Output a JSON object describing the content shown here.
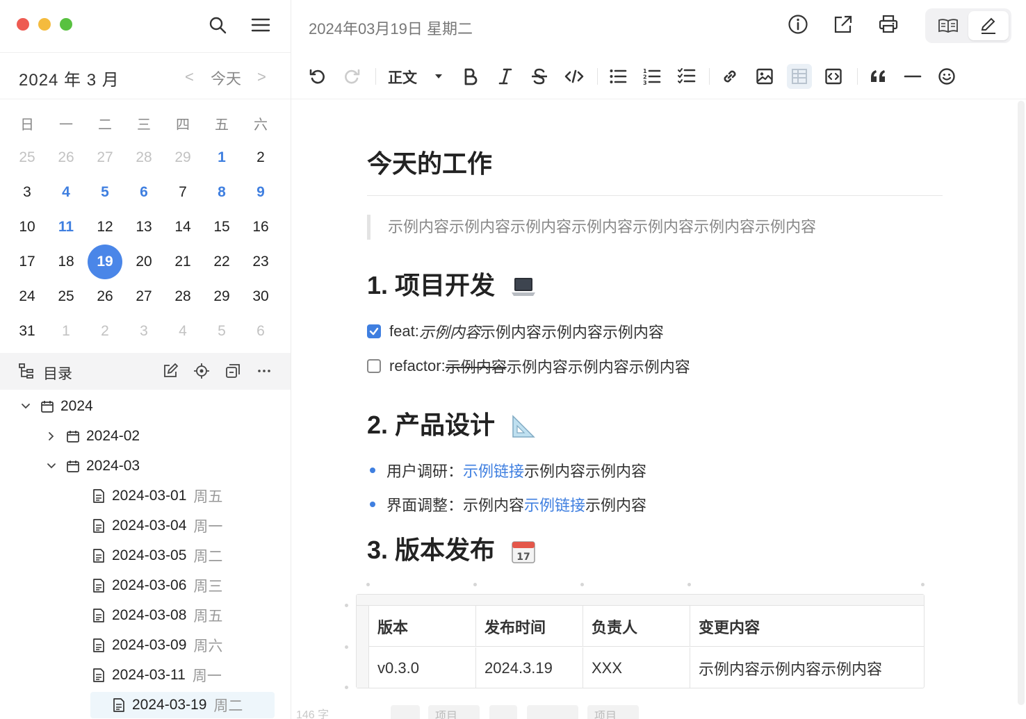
{
  "sidebar": {
    "top_icons": [
      "search-icon",
      "menu-icon"
    ],
    "month_title": "2024 年 3 月",
    "prev_label": "<",
    "today_label": "今天",
    "next_label": ">",
    "weekdays": [
      "日",
      "一",
      "二",
      "三",
      "四",
      "五",
      "六"
    ],
    "weeks": [
      [
        {
          "d": "25",
          "s": "muted"
        },
        {
          "d": "26",
          "s": "muted"
        },
        {
          "d": "27",
          "s": "muted"
        },
        {
          "d": "28",
          "s": "muted"
        },
        {
          "d": "29",
          "s": "muted"
        },
        {
          "d": "1",
          "s": "has"
        },
        {
          "d": "2",
          "s": ""
        }
      ],
      [
        {
          "d": "3",
          "s": ""
        },
        {
          "d": "4",
          "s": "has"
        },
        {
          "d": "5",
          "s": "has"
        },
        {
          "d": "6",
          "s": "has"
        },
        {
          "d": "7",
          "s": ""
        },
        {
          "d": "8",
          "s": "has"
        },
        {
          "d": "9",
          "s": "has"
        }
      ],
      [
        {
          "d": "10",
          "s": ""
        },
        {
          "d": "11",
          "s": "has"
        },
        {
          "d": "12",
          "s": ""
        },
        {
          "d": "13",
          "s": ""
        },
        {
          "d": "14",
          "s": ""
        },
        {
          "d": "15",
          "s": ""
        },
        {
          "d": "16",
          "s": ""
        }
      ],
      [
        {
          "d": "17",
          "s": ""
        },
        {
          "d": "18",
          "s": ""
        },
        {
          "d": "19",
          "s": "selected"
        },
        {
          "d": "20",
          "s": ""
        },
        {
          "d": "21",
          "s": ""
        },
        {
          "d": "22",
          "s": ""
        },
        {
          "d": "23",
          "s": ""
        }
      ],
      [
        {
          "d": "24",
          "s": ""
        },
        {
          "d": "25",
          "s": ""
        },
        {
          "d": "26",
          "s": ""
        },
        {
          "d": "27",
          "s": ""
        },
        {
          "d": "28",
          "s": ""
        },
        {
          "d": "29",
          "s": ""
        },
        {
          "d": "30",
          "s": ""
        }
      ],
      [
        {
          "d": "31",
          "s": ""
        },
        {
          "d": "1",
          "s": "muted"
        },
        {
          "d": "2",
          "s": "muted"
        },
        {
          "d": "3",
          "s": "muted"
        },
        {
          "d": "4",
          "s": "muted"
        },
        {
          "d": "5",
          "s": "muted"
        },
        {
          "d": "6",
          "s": "muted"
        }
      ]
    ],
    "toc": {
      "title": "目录",
      "icons": [
        "edit-icon",
        "locate-icon",
        "collapse-icon",
        "more-icon"
      ]
    },
    "tree": [
      {
        "label": "2024",
        "level": 0,
        "type": "folder",
        "expanded": true,
        "week": ""
      },
      {
        "label": "2024-02",
        "level": 1,
        "type": "folder",
        "expanded": false,
        "week": ""
      },
      {
        "label": "2024-03",
        "level": 1,
        "type": "folder",
        "expanded": true,
        "week": ""
      },
      {
        "label": "2024-03-01",
        "level": 2,
        "type": "file",
        "week": "周五"
      },
      {
        "label": "2024-03-04",
        "level": 2,
        "type": "file",
        "week": "周一"
      },
      {
        "label": "2024-03-05",
        "level": 2,
        "type": "file",
        "week": "周二"
      },
      {
        "label": "2024-03-06",
        "level": 2,
        "type": "file",
        "week": "周三"
      },
      {
        "label": "2024-03-08",
        "level": 2,
        "type": "file",
        "week": "周五"
      },
      {
        "label": "2024-03-09",
        "level": 2,
        "type": "file",
        "week": "周六"
      },
      {
        "label": "2024-03-11",
        "level": 2,
        "type": "file",
        "week": "周一"
      },
      {
        "label": "2024-03-19",
        "level": 2,
        "type": "file",
        "week": "周二",
        "active": true
      }
    ]
  },
  "header": {
    "date_title": "2024年03月19日 星期二",
    "icons": [
      "info-icon",
      "export-icon",
      "print-icon"
    ],
    "modes": [
      "read-mode-icon",
      "edit-mode-icon"
    ]
  },
  "toolbar": {
    "paragraph_label": "正文",
    "buttons": [
      "undo-icon",
      "redo-icon",
      "bold-icon",
      "italic-icon",
      "strikethrough-icon",
      "code-icon",
      "bullet-list-icon",
      "ordered-list-icon",
      "task-list-icon",
      "link-icon",
      "image-icon",
      "table-icon",
      "code-block-icon",
      "quote-icon",
      "divider-icon",
      "emoji-icon"
    ]
  },
  "doc": {
    "title": "今天的工作",
    "quote": "示例内容示例内容示例内容示例内容示例内容示例内容示例内容",
    "sec1": "1. 项目开发",
    "task1_label": "feat: ",
    "task1_italic": "示例内容",
    "task1_rest": "示例内容示例内容示例内容",
    "task1_checked": true,
    "task2_label": "refactor: ",
    "task2_strike": "示例内容",
    "task2_rest": "示例内容示例内容示例内容",
    "task2_checked": false,
    "sec2": "2. 产品设计",
    "b1_prefix": "用户调研：",
    "b1_link": "示例链接",
    "b1_rest": "示例内容示例内容",
    "b2_prefix": "界面调整：示例内容",
    "b2_link": "示例链接",
    "b2_rest": "示例内容",
    "sec3": "3. 版本发布",
    "table": {
      "headers": [
        "版本",
        "发布时间",
        "负责人",
        "变更内容"
      ],
      "rows": [
        [
          "v0.3.0",
          "2024.3.19",
          "XXX",
          "示例内容示例内容示例内容"
        ]
      ]
    },
    "word_count": "146 字",
    "bottom_chips": [
      "",
      "项目",
      "",
      "",
      "项目"
    ]
  },
  "colors": {
    "accent": "#3f7fe0",
    "selected_day": "#4a86e8",
    "traffic_red": "#ee5b52",
    "traffic_yellow": "#f4bb3e",
    "traffic_green": "#58c140"
  }
}
